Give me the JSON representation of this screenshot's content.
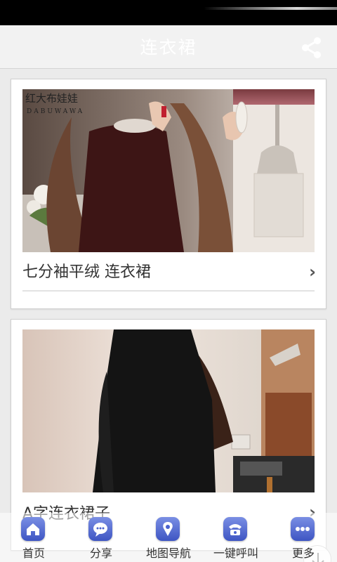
{
  "header": {
    "title": "连衣裙"
  },
  "cards": [
    {
      "title": "七分袖平绒 连衣裙",
      "watermark": "红大布娃娃",
      "watermark_sub": "DABUWAWA"
    },
    {
      "title": "A字连衣裙子"
    }
  ],
  "nav": [
    {
      "label": "首页",
      "icon": "home-icon"
    },
    {
      "label": "分享",
      "icon": "chat-icon"
    },
    {
      "label": "地图导航",
      "icon": "map-pin-icon"
    },
    {
      "label": "一键呼叫",
      "icon": "phone-icon"
    },
    {
      "label": "更多",
      "icon": "more-icon"
    }
  ],
  "colors": {
    "nav_icon": "#4a62cf",
    "header_bg": "#f2f2f2",
    "title": "#ffffff"
  }
}
